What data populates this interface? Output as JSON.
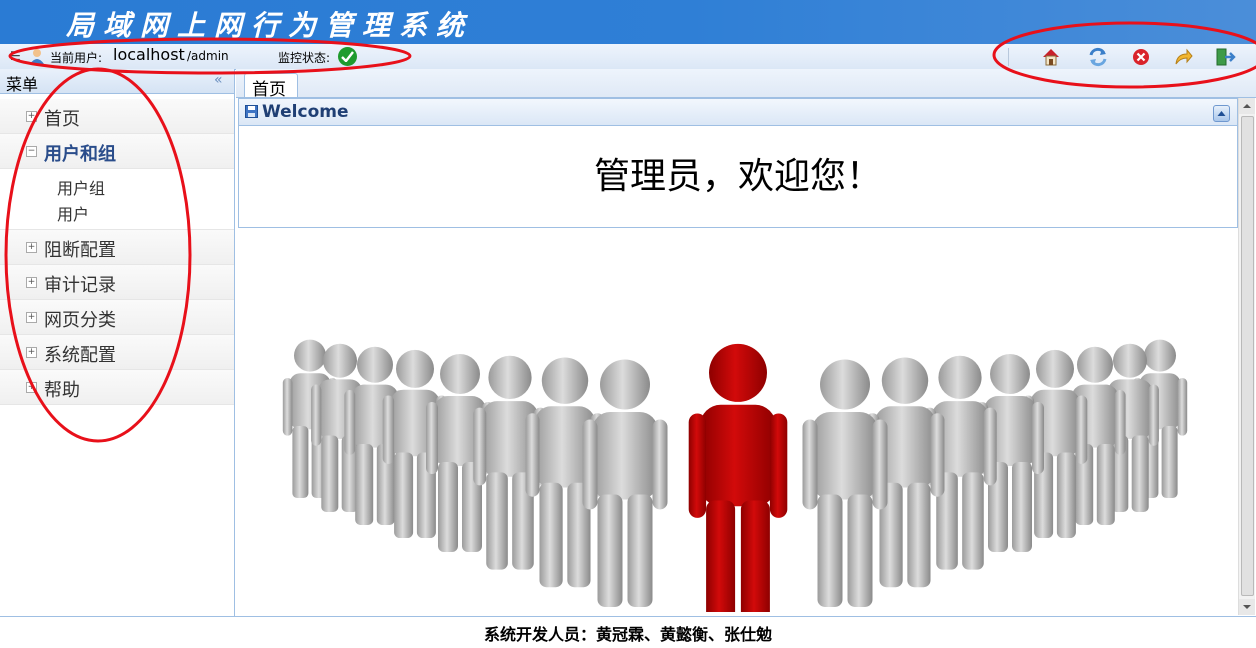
{
  "app": {
    "title": "局域网上网行为管理系统"
  },
  "topbar": {
    "user_label": "当前用户:",
    "user_name": "localhost",
    "user_role": "/admin",
    "monitor_label": "监控状态:",
    "monitor_status_icon": "check-circle-icon",
    "buttons": [
      {
        "icon": "home-icon"
      },
      {
        "icon": "refresh-icon"
      },
      {
        "icon": "close-icon"
      },
      {
        "icon": "back-arrow-icon"
      },
      {
        "icon": "logout-icon"
      }
    ]
  },
  "sidebar": {
    "title": "菜单",
    "items": [
      {
        "label": "首页",
        "expanded": false
      },
      {
        "label": "用户和组",
        "expanded": true,
        "children": [
          "用户组",
          "用户"
        ]
      },
      {
        "label": "阻断配置",
        "expanded": false
      },
      {
        "label": "审计记录",
        "expanded": false
      },
      {
        "label": "网页分类",
        "expanded": false
      },
      {
        "label": "系统配置",
        "expanded": false
      },
      {
        "label": "帮助",
        "expanded": false
      }
    ]
  },
  "tabs": [
    {
      "label": "首页"
    }
  ],
  "panel": {
    "title": "Welcome",
    "message": "管理员，欢迎您！"
  },
  "footer": {
    "text": "系统开发人员：黄冠霖、黄懿衡、张仕勉"
  },
  "colors": {
    "banner": "#2f7fd6",
    "accent": "#1f3f74",
    "highlight_figure": "#c10000",
    "annotation": "#e8101a"
  }
}
